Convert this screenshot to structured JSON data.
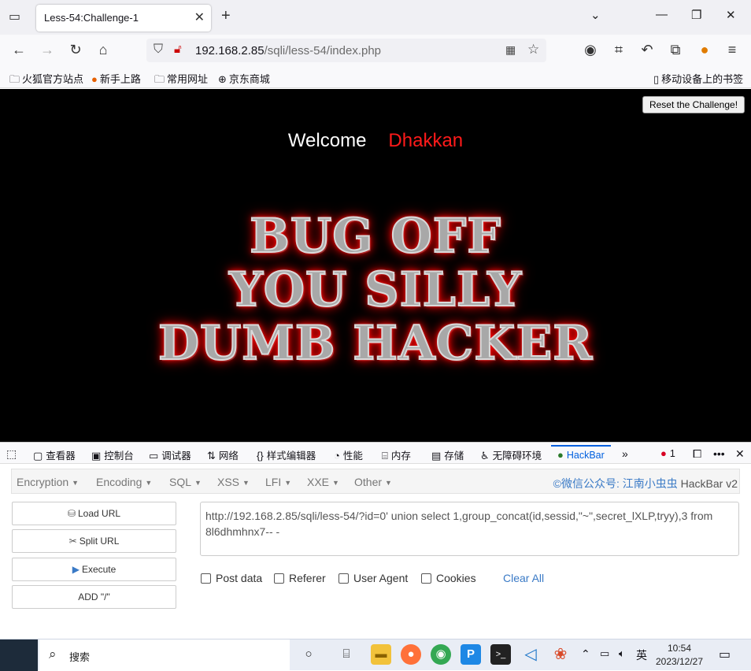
{
  "browser": {
    "tab_title": "Less-54:Challenge-1",
    "url_host": "192.168.2.85",
    "url_path": "/sqli/less-54/index.php",
    "new_tab": "+",
    "close_tab": "✕"
  },
  "bookmarks": {
    "items": [
      {
        "label": "火狐官方站点",
        "icon": "folder-icon"
      },
      {
        "label": "新手上路",
        "icon": "firefox-icon"
      },
      {
        "label": "常用网址",
        "icon": "folder-icon"
      },
      {
        "label": "京东商城",
        "icon": "globe-icon"
      }
    ],
    "mobile": "移动设备上的书签"
  },
  "page": {
    "reset_button": "Reset the Challenge!",
    "welcome": "Welcome",
    "name": "Dhakkan",
    "banner_lines": [
      "BUG OFF",
      "YOU SILLY",
      "DUMB HACKER"
    ]
  },
  "devtools": {
    "tabs": [
      "查看器",
      "控制台",
      "调试器",
      "网络",
      "样式编辑器",
      "性能",
      "内存",
      "存储",
      "无障碍环境",
      "HackBar"
    ],
    "error_count": "1"
  },
  "hackbar": {
    "menu": [
      "Encryption",
      "Encoding",
      "SQL",
      "XSS",
      "LFI",
      "XXE",
      "Other"
    ],
    "brand": "©微信公众号: 江南小虫虫",
    "brand_version": "HackBar v2",
    "buttons": [
      "Load URL",
      "Split URL",
      "Execute",
      "ADD \"/\""
    ],
    "url_value": "http://192.168.2.85/sqli/less-54/?id=0' union select 1,group_concat(id,sessid,\"~\",secret_lXLP,tryy),3 from 8l6dhmhnx7-- -",
    "checkboxes": [
      "Post data",
      "Referer",
      "User Agent",
      "Cookies"
    ],
    "clear_all": "Clear All"
  },
  "taskbar": {
    "search": "搜索",
    "lang": "英",
    "time": "10:54",
    "date": "2023/12/27"
  },
  "colors": {
    "accent": "#0060df",
    "name_red": "#ff1a1a",
    "link_blue": "#3a7ac6"
  }
}
